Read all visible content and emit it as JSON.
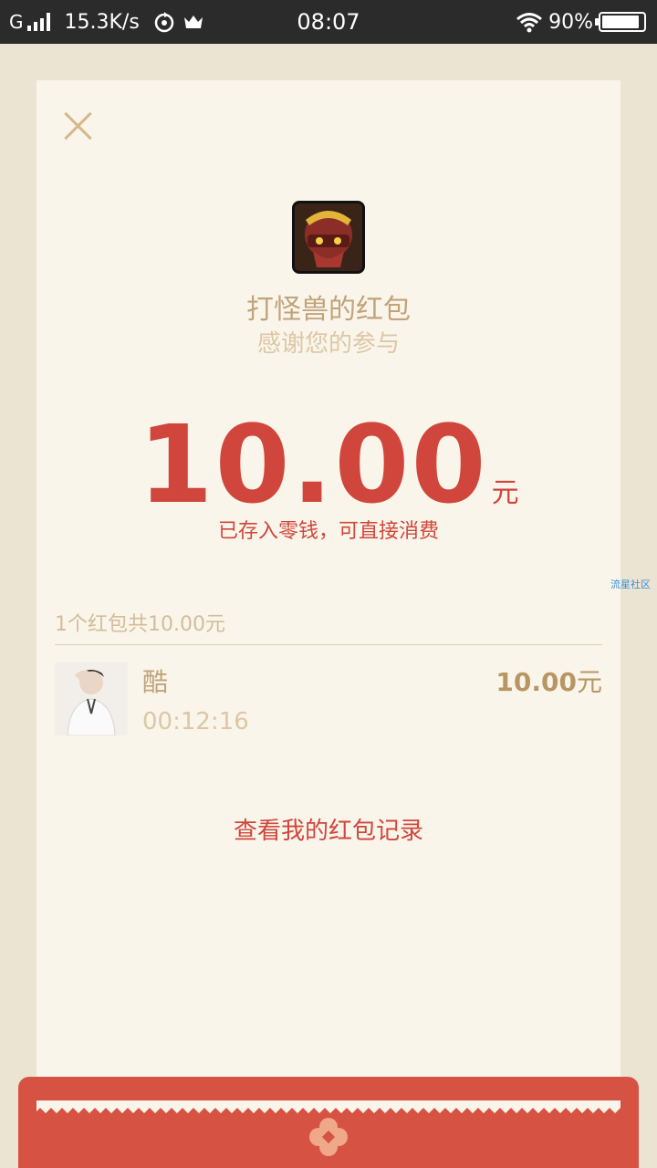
{
  "status_bar": {
    "carrier": "G",
    "speed": "15.3K/s",
    "time": "08:07",
    "battery": "90%",
    "battery_level": 0.9
  },
  "envelope": {
    "sender_title": "打怪兽的红包",
    "subtitle": "感谢您的参与",
    "amount": "10.00",
    "unit": "元",
    "saved_note": "已存入零钱，可直接消费",
    "summary": "1个红包共10.00元",
    "record_link": "查看我的红包记录"
  },
  "receiver": {
    "name": "酷",
    "time": "00:12:16",
    "amount": "10.00",
    "unit": "元"
  },
  "watermark": "流星社区",
  "colors": {
    "accent_red": "#d0463c",
    "gold": "#c1a37a",
    "card_bg": "#faf5ea",
    "page_bg": "#ece4d2"
  },
  "icons": [
    "close-icon",
    "wifi-icon",
    "battery-icon",
    "signal-icon",
    "envelope-seal-icon"
  ]
}
